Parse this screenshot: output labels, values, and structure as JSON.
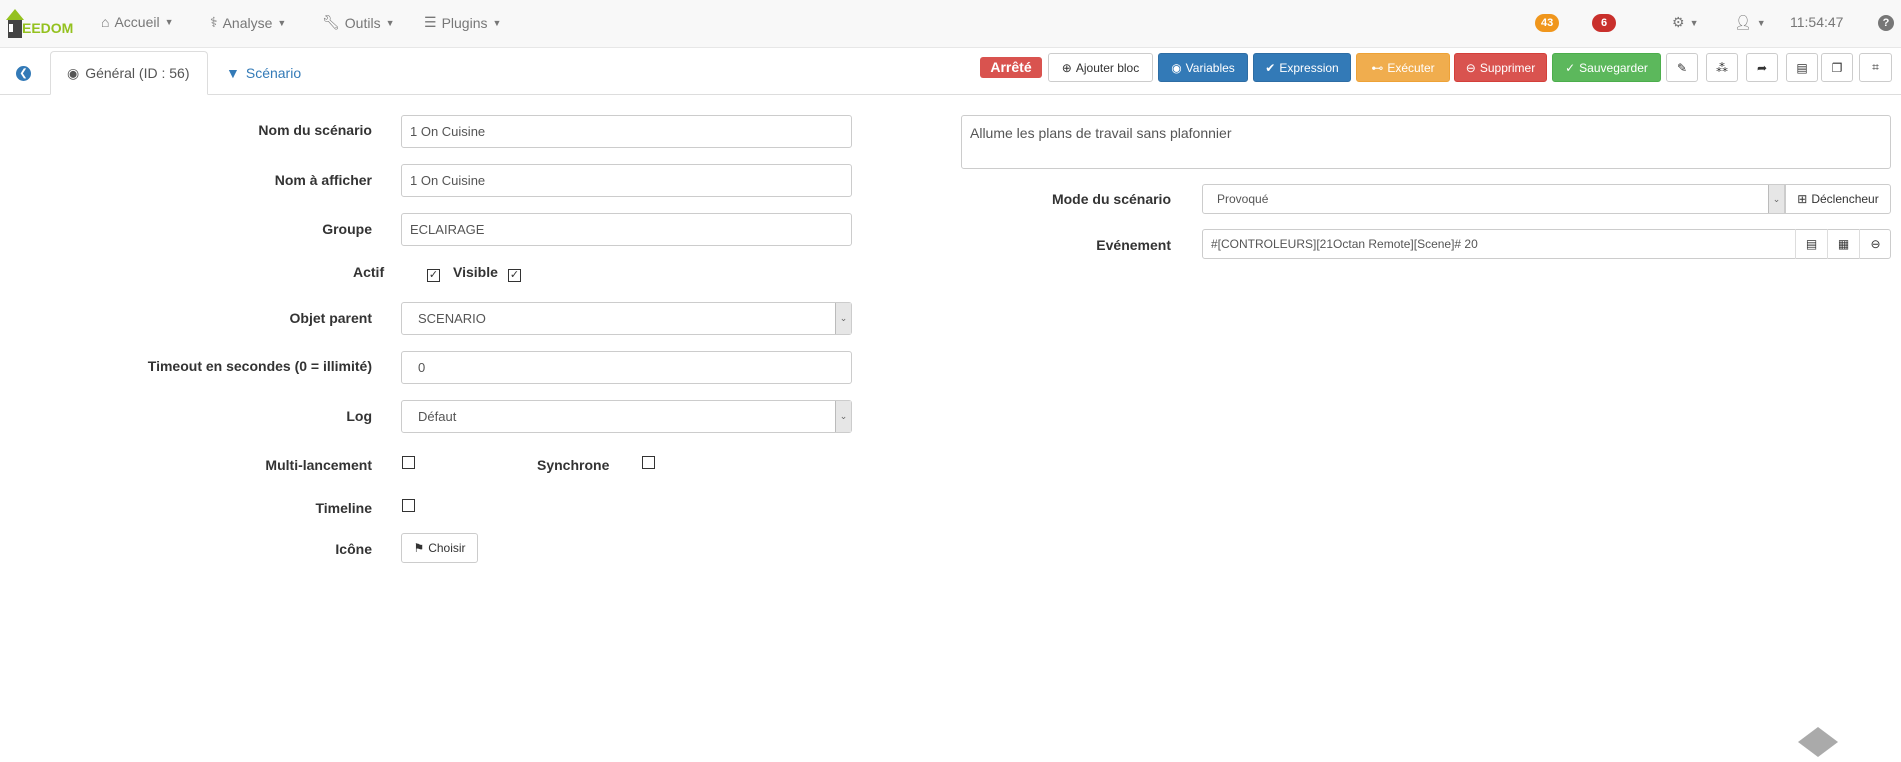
{
  "navbar": {
    "logo": "EEDOM",
    "menu": [
      {
        "label": "Accueil",
        "icon": "home-icon"
      },
      {
        "label": "Analyse",
        "icon": "stethoscope-icon"
      },
      {
        "label": "Outils",
        "icon": "wrench-icon"
      },
      {
        "label": "Plugins",
        "icon": "tasks-icon"
      }
    ],
    "badge_orange": "43",
    "badge_red": "6",
    "time": "11:54:47",
    "colors": {
      "orange": "#f0961c",
      "red": "#c9302c"
    }
  },
  "tabs": {
    "general": "Général (ID : 56)",
    "scenario": "Scénario"
  },
  "toolbar": {
    "status": "Arrêté",
    "add_block": "Ajouter bloc",
    "variables": "Variables",
    "expression": "Expression",
    "execute": "Exécuter",
    "delete": "Supprimer",
    "save": "Sauvegarder"
  },
  "form": {
    "name_label": "Nom du scénario",
    "name_value": "1 On Cuisine",
    "display_label": "Nom à afficher",
    "display_value": "1 On Cuisine",
    "group_label": "Groupe",
    "group_value": "ECLAIRAGE",
    "active_label": "Actif",
    "visible_label": "Visible",
    "parent_label": "Objet parent",
    "parent_value": "SCENARIO",
    "timeout_label": "Timeout en secondes (0 = illimité)",
    "timeout_value": "0",
    "log_label": "Log",
    "log_value": "Défaut",
    "multi_label": "Multi-lancement",
    "sync_label": "Synchrone",
    "timeline_label": "Timeline",
    "icon_label": "Icône",
    "icon_button": "Choisir"
  },
  "right": {
    "description": "Allume les plans de travail sans plafonnier",
    "mode_label": "Mode du scénario",
    "mode_value": "Provoqué",
    "trigger_button": "Déclencheur",
    "event_label": "Evénement",
    "event_value": "#[CONTROLEURS][21Octan Remote][Scene]# 20"
  }
}
